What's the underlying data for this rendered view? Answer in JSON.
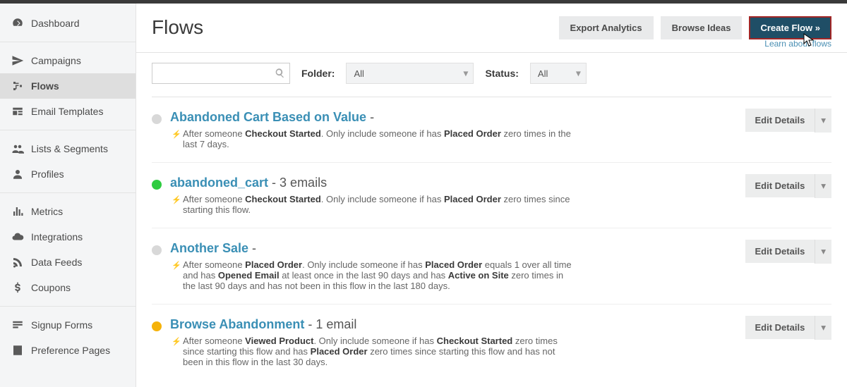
{
  "sidebar": {
    "items": [
      {
        "label": "Dashboard",
        "active": false
      },
      {
        "label": "Campaigns",
        "active": false
      },
      {
        "label": "Flows",
        "active": true
      },
      {
        "label": "Email Templates",
        "active": false
      },
      {
        "label": "Lists & Segments",
        "active": false
      },
      {
        "label": "Profiles",
        "active": false
      },
      {
        "label": "Metrics",
        "active": false
      },
      {
        "label": "Integrations",
        "active": false
      },
      {
        "label": "Data Feeds",
        "active": false
      },
      {
        "label": "Coupons",
        "active": false
      },
      {
        "label": "Signup Forms",
        "active": false
      },
      {
        "label": "Preference Pages",
        "active": false
      }
    ]
  },
  "header": {
    "title": "Flows",
    "export_label": "Export Analytics",
    "browse_label": "Browse Ideas",
    "create_label": "Create Flow »",
    "learn_text": "Learn about flows"
  },
  "filters": {
    "folder_label": "Folder:",
    "folder_value": "All",
    "status_label": "Status:",
    "status_value": "All"
  },
  "edit_label": "Edit Details",
  "flows": [
    {
      "name": "Abandoned Cart Based on Value",
      "suffix": " - ",
      "dot": "#d8d8d8",
      "desc": "After someone <b>Checkout Started</b>. Only include someone if has <b>Placed Order</b> zero times in the last 7 days."
    },
    {
      "name": "abandoned_cart",
      "suffix": " - 3 emails",
      "dot": "#2ecc40",
      "desc": "After someone <b>Checkout Started</b>. Only include someone if has <b>Placed Order</b> zero times since starting this flow."
    },
    {
      "name": "Another Sale",
      "suffix": " - ",
      "dot": "#d8d8d8",
      "desc": "After someone <b>Placed Order</b>. Only include someone if has <b>Placed Order</b> equals 1 over all time and has <b>Opened Email</b> at least once in the last 90 days and has <b>Active on Site</b> zero times in the last 90 days and has not been in this flow in the last 180 days."
    },
    {
      "name": "Browse Abandonment",
      "suffix": " - 1 email",
      "dot": "#f5b20a",
      "desc": "After someone <b>Viewed Product</b>. Only include someone if has <b>Checkout Started</b> zero times since starting this flow and has <b>Placed Order</b> zero times since starting this flow and has not been in this flow in the last 30 days."
    }
  ]
}
